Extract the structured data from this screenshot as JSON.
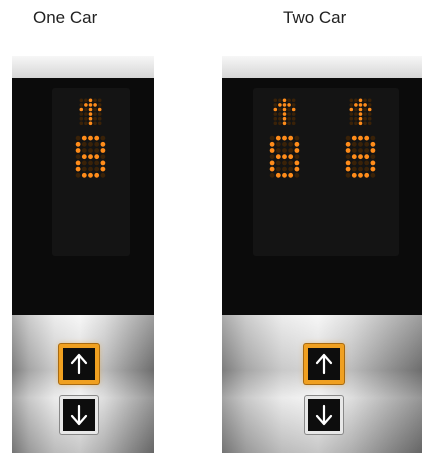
{
  "captions": {
    "one_car": "One Car",
    "two_car": "Two Car"
  },
  "panels": [
    {
      "name": "one-car-panel",
      "cars": [
        {
          "direction": "up",
          "floor": "8"
        }
      ],
      "buttons": {
        "up": "up-arrow-icon",
        "down": "down-arrow-icon"
      }
    },
    {
      "name": "two-car-panel",
      "cars": [
        {
          "direction": "up",
          "floor": "8"
        },
        {
          "direction": "up",
          "floor": "8"
        }
      ],
      "buttons": {
        "up": "up-arrow-icon",
        "down": "down-arrow-icon"
      }
    }
  ],
  "colors": {
    "led": "#ff8c1a",
    "led_dim": "#3a2208",
    "up_button_ring": "#f0a020",
    "down_button_ring": "#e8e8e8"
  }
}
